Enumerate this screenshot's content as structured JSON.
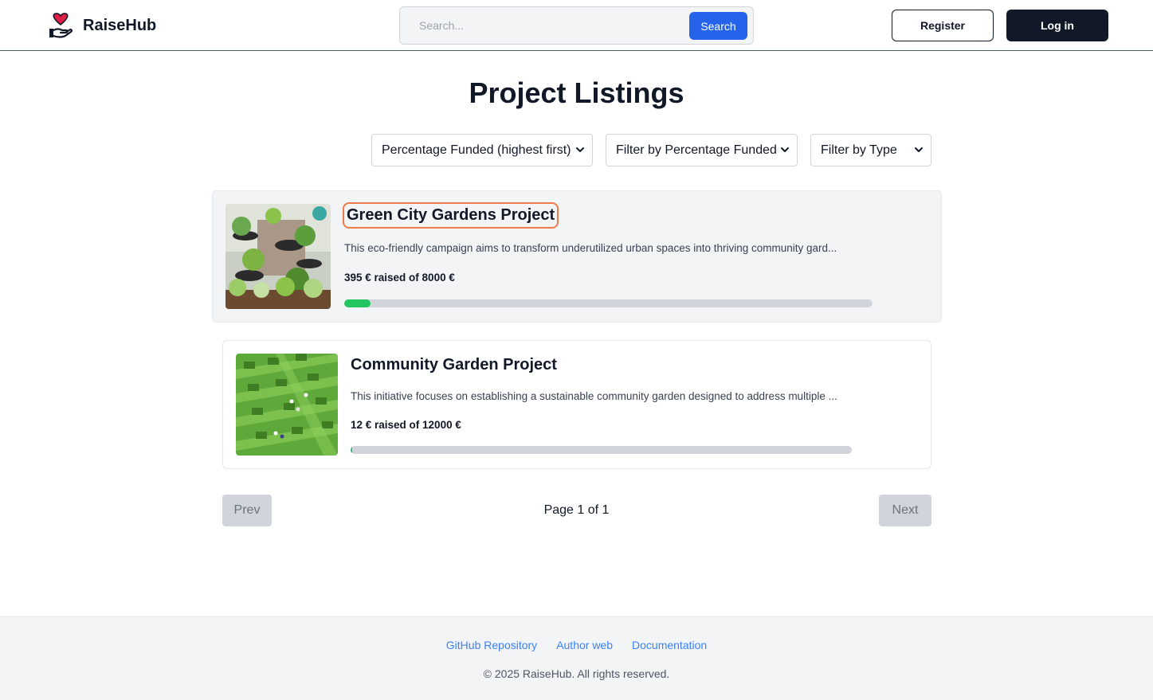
{
  "header": {
    "brand_name": "RaiseHub",
    "search_placeholder": "Search...",
    "search_button": "Search",
    "register_button": "Register",
    "login_button": "Log in"
  },
  "page_title": "Project Listings",
  "filters": {
    "sort": "Percentage Funded (highest first)",
    "percentage": "Filter by Percentage Funded",
    "type": "Filter by Type"
  },
  "projects": [
    {
      "title": "Green City Gardens Project",
      "description": "This eco-friendly campaign aims to transform underutilized urban spaces into thriving community gard...",
      "raised_text": "395 € raised of 8000 €",
      "raised": 395,
      "goal": 8000,
      "highlighted": true
    },
    {
      "title": "Community Garden Project",
      "description": "This initiative focuses on establishing a sustainable community garden designed to address multiple ...",
      "raised_text": "12 € raised of 12000 €",
      "raised": 12,
      "goal": 12000,
      "highlighted": false
    }
  ],
  "pagination": {
    "prev": "Prev",
    "page_text": "Page 1 of 1",
    "next": "Next"
  },
  "footer": {
    "links": [
      "GitHub Repository",
      "Author web",
      "Documentation"
    ],
    "copyright": "© 2025 RaiseHub. All rights reserved."
  },
  "colors": {
    "primary": "#2563eb",
    "dark": "#111827",
    "progress": "#22c55e",
    "highlight_outline": "#ef7a4a",
    "link": "#3b82f6"
  }
}
